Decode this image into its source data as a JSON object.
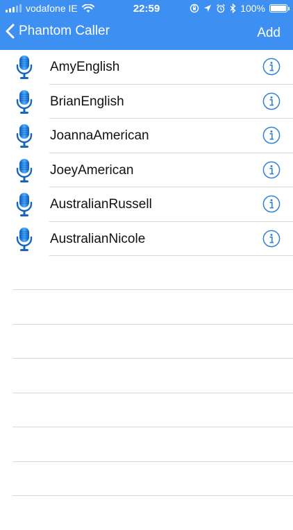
{
  "status_bar": {
    "carrier": "vodafone IE",
    "time": "22:59",
    "battery": "100%"
  },
  "nav": {
    "back_label": "Phantom Caller",
    "add_label": "Add"
  },
  "voices": [
    {
      "name": "AmyEnglish"
    },
    {
      "name": "BrianEnglish"
    },
    {
      "name": "JoannaAmerican"
    },
    {
      "name": "JoeyAmerican"
    },
    {
      "name": "AustralianRussell"
    },
    {
      "name": "AustralianNicole"
    }
  ],
  "colors": {
    "header": "#3d8ff2",
    "mic_blue": "#1e88e5",
    "info_blue": "#2f80d6"
  },
  "icons": {
    "mic": "microphone-icon",
    "info": "info-icon",
    "back": "chevron-left-icon"
  }
}
